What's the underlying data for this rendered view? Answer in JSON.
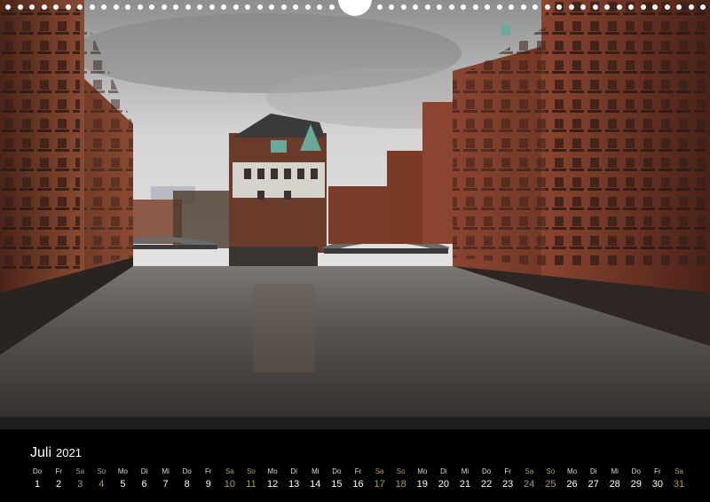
{
  "calendar": {
    "month": "Juli",
    "year": "2021",
    "days": [
      {
        "wd": "Do",
        "n": "1",
        "we": false
      },
      {
        "wd": "Fr",
        "n": "2",
        "we": false
      },
      {
        "wd": "Sa",
        "n": "3",
        "we": true
      },
      {
        "wd": "So",
        "n": "4",
        "we": true
      },
      {
        "wd": "Mo",
        "n": "5",
        "we": false
      },
      {
        "wd": "Di",
        "n": "6",
        "we": false
      },
      {
        "wd": "Mi",
        "n": "7",
        "we": false
      },
      {
        "wd": "Do",
        "n": "8",
        "we": false
      },
      {
        "wd": "Fr",
        "n": "9",
        "we": false
      },
      {
        "wd": "Sa",
        "n": "10",
        "we": true
      },
      {
        "wd": "So",
        "n": "11",
        "we": true
      },
      {
        "wd": "Mo",
        "n": "12",
        "we": false
      },
      {
        "wd": "Di",
        "n": "13",
        "we": false
      },
      {
        "wd": "Mi",
        "n": "14",
        "we": false
      },
      {
        "wd": "Do",
        "n": "15",
        "we": false
      },
      {
        "wd": "Fr",
        "n": "16",
        "we": false
      },
      {
        "wd": "Sa",
        "n": "17",
        "we": true
      },
      {
        "wd": "So",
        "n": "18",
        "we": true
      },
      {
        "wd": "Mo",
        "n": "19",
        "we": false
      },
      {
        "wd": "Di",
        "n": "20",
        "we": false
      },
      {
        "wd": "Mi",
        "n": "21",
        "we": false
      },
      {
        "wd": "Do",
        "n": "22",
        "we": false
      },
      {
        "wd": "Fr",
        "n": "23",
        "we": false
      },
      {
        "wd": "Sa",
        "n": "24",
        "we": true
      },
      {
        "wd": "So",
        "n": "25",
        "we": true
      },
      {
        "wd": "Mo",
        "n": "26",
        "we": false
      },
      {
        "wd": "Di",
        "n": "27",
        "we": false
      },
      {
        "wd": "Mi",
        "n": "28",
        "we": false
      },
      {
        "wd": "Do",
        "n": "29",
        "we": false
      },
      {
        "wd": "Fr",
        "n": "30",
        "we": false
      },
      {
        "wd": "Sa",
        "n": "31",
        "we": true
      }
    ]
  },
  "colors": {
    "weekend": "#b0a04a",
    "brick": "#7a3a26",
    "sky": "#cfcfcf",
    "water": "#4a4744"
  }
}
